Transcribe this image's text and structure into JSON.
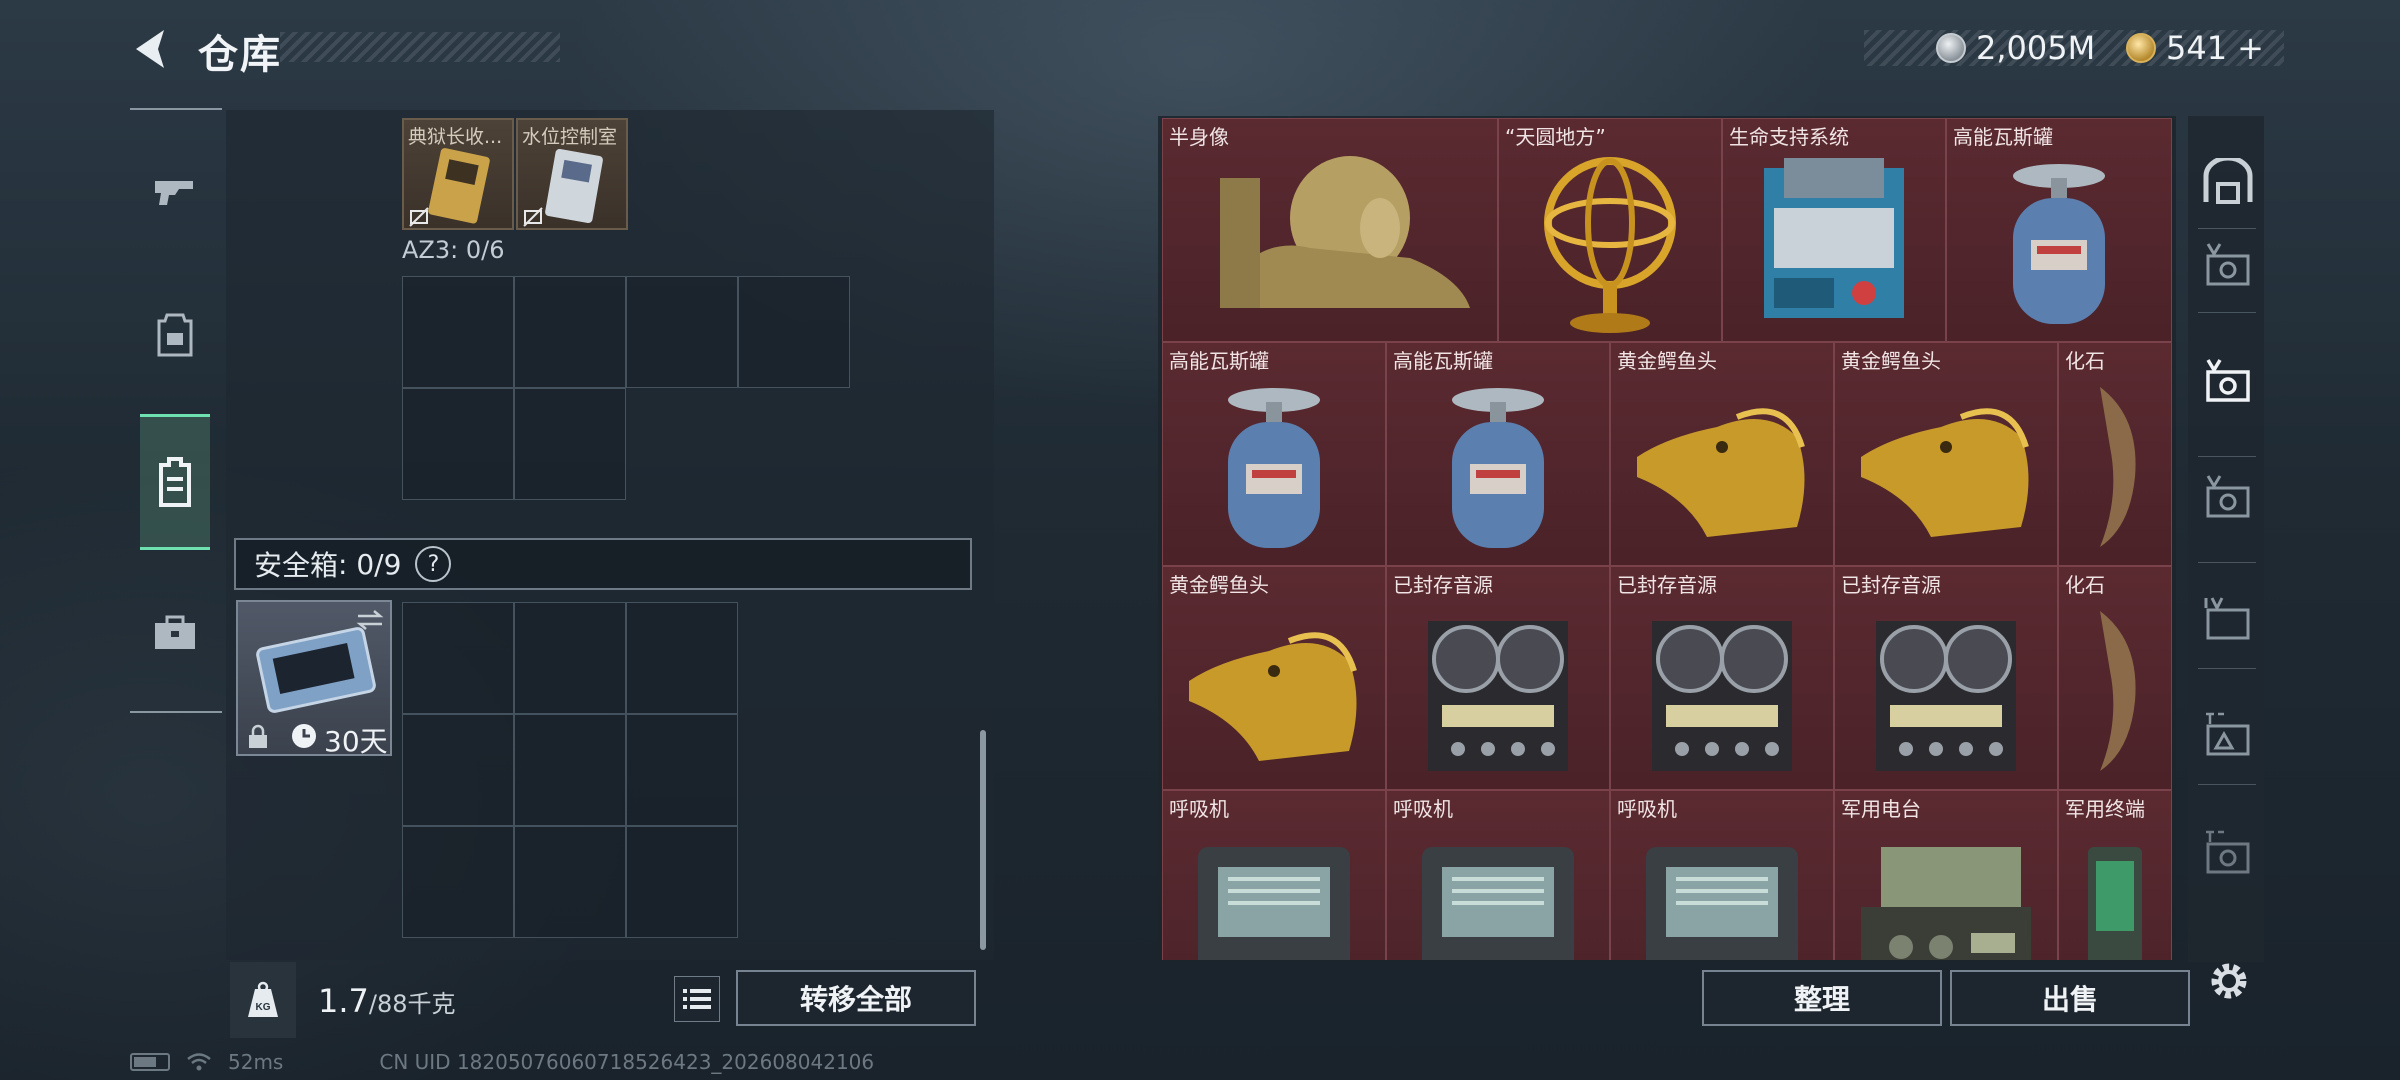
{
  "header": {
    "title": "仓库",
    "currency_silver": "2,005M",
    "currency_gold": "541",
    "currency_gold_add": "+"
  },
  "left_nav": {
    "items": [
      {
        "name": "weapons",
        "icon": "gun-icon"
      },
      {
        "name": "equipment",
        "icon": "armor-icon"
      },
      {
        "name": "backpack",
        "icon": "backpack-icon",
        "active": true
      },
      {
        "name": "case",
        "icon": "briefcase-icon"
      }
    ]
  },
  "storage": {
    "mini_items": [
      {
        "label": "典狱长收..."
      },
      {
        "label": "水位控制室"
      }
    ],
    "az3_label": "AZ3: 0/6",
    "safe_box_label": "安全箱",
    "safe_box_count": ": 0/9",
    "help": "?",
    "safe_item_timer": "30天"
  },
  "bottom_left": {
    "weight_value": "1.7",
    "weight_cap": "/88千克",
    "weight_icon_text": "KG",
    "transfer_all": "转移全部"
  },
  "items": [
    {
      "label": "半身像",
      "kind": "bust"
    },
    {
      "label": "“天圆地方”",
      "kind": "globe"
    },
    {
      "label": "生命支持系统",
      "kind": "machine"
    },
    {
      "label": "高能瓦斯罐",
      "kind": "gas"
    },
    {
      "label": "高能瓦斯罐",
      "kind": "gas"
    },
    {
      "label": "高能瓦斯罐",
      "kind": "gas"
    },
    {
      "label": "黄金鳄鱼头",
      "kind": "croc"
    },
    {
      "label": "黄金鳄鱼头",
      "kind": "croc"
    },
    {
      "label": "化石",
      "kind": "fossil"
    },
    {
      "label": "黄金鳄鱼头",
      "kind": "croc"
    },
    {
      "label": "已封存音源",
      "kind": "reel"
    },
    {
      "label": "已封存音源",
      "kind": "reel"
    },
    {
      "label": "已封存音源",
      "kind": "reel"
    },
    {
      "label": "化石",
      "kind": "fossil"
    },
    {
      "label": "呼吸机",
      "kind": "vent"
    },
    {
      "label": "呼吸机",
      "kind": "vent"
    },
    {
      "label": "呼吸机",
      "kind": "vent"
    },
    {
      "label": "军用电台",
      "kind": "radio"
    },
    {
      "label": "军用终端",
      "kind": "terminal"
    }
  ],
  "right_nav": {
    "items": [
      "storage-icon",
      "vault-v-icon",
      "vault-v-active-icon",
      "vault-v2-icon",
      "vault-iv-icon",
      "vault-gti-icon",
      "vault-gti2-icon"
    ]
  },
  "bottom_right": {
    "sort": "整理",
    "sell": "出售"
  },
  "status": {
    "ping": "52ms",
    "uid": "CN UID 1820507606071852642​3_202608042106"
  }
}
